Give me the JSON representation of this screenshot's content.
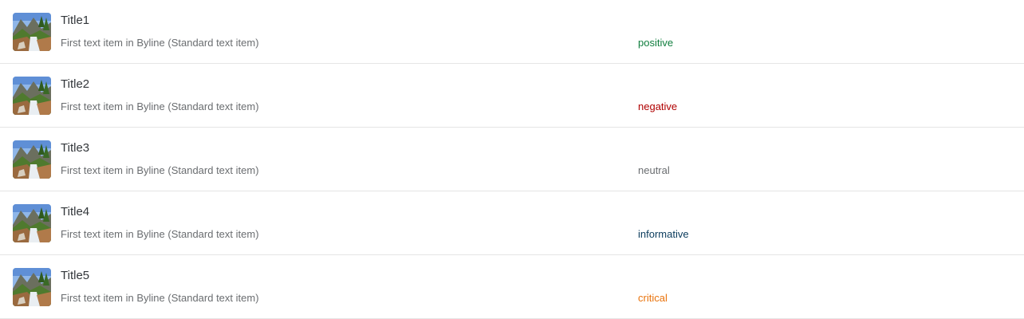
{
  "items": [
    {
      "title": "Title1",
      "byline": "First text item in Byline (Standard text item)",
      "status": "positive",
      "status_color": "#107e3e",
      "thumbnail": "mountain-waterfall-image"
    },
    {
      "title": "Title2",
      "byline": "First text item in Byline (Standard text item)",
      "status": "negative",
      "status_color": "#b00000",
      "thumbnail": "mountain-waterfall-image"
    },
    {
      "title": "Title3",
      "byline": "First text item in Byline (Standard text item)",
      "status": "neutral",
      "status_color": "#6a6d70",
      "thumbnail": "mountain-waterfall-image"
    },
    {
      "title": "Title4",
      "byline": "First text item in Byline (Standard text item)",
      "status": "informative",
      "status_color": "#0a3b5c",
      "thumbnail": "mountain-waterfall-image"
    },
    {
      "title": "Title5",
      "byline": "First text item in Byline (Standard text item)",
      "status": "critical",
      "status_color": "#e9730c",
      "thumbnail": "mountain-waterfall-image"
    }
  ]
}
